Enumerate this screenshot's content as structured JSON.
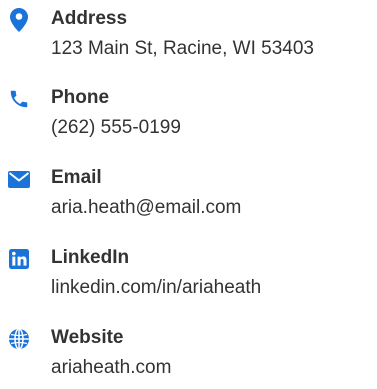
{
  "theme": {
    "icon_color": "#1a73d8",
    "text_color": "#333333"
  },
  "contact": {
    "items": [
      {
        "icon": "map-pin-icon",
        "label": "Address",
        "value": "123 Main St, Racine, WI 53403"
      },
      {
        "icon": "phone-icon",
        "label": "Phone",
        "value": "(262) 555-0199"
      },
      {
        "icon": "envelope-icon",
        "label": "Email",
        "value": "aria.heath@email.com"
      },
      {
        "icon": "linkedin-icon",
        "label": "LinkedIn",
        "value": "linkedin.com/in/ariaheath"
      },
      {
        "icon": "globe-icon",
        "label": "Website",
        "value": "ariaheath.com"
      }
    ]
  }
}
